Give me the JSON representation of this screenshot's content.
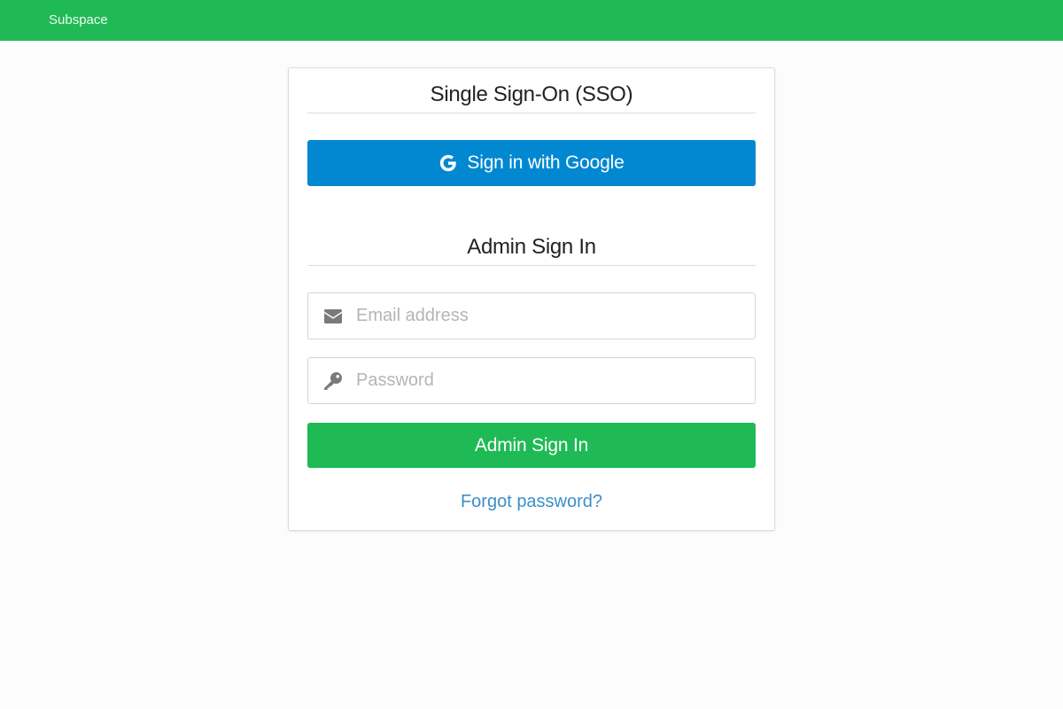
{
  "navbar": {
    "brand": "Subspace",
    "background_color": "#1fba55"
  },
  "sso_section": {
    "title": "Single Sign-On (SSO)",
    "google_button_label": "Sign in with Google",
    "google_button_icon": "google-g-icon",
    "google_button_color": "#0288d1"
  },
  "admin_section": {
    "title": "Admin Sign In",
    "email": {
      "placeholder": "Email address",
      "value": "",
      "icon": "envelope-icon"
    },
    "password": {
      "placeholder": "Password",
      "value": "",
      "icon": "key-icon"
    },
    "submit_label": "Admin Sign In",
    "submit_color": "#1fba55",
    "forgot_label": "Forgot password?",
    "link_color": "#3a8fc8"
  }
}
